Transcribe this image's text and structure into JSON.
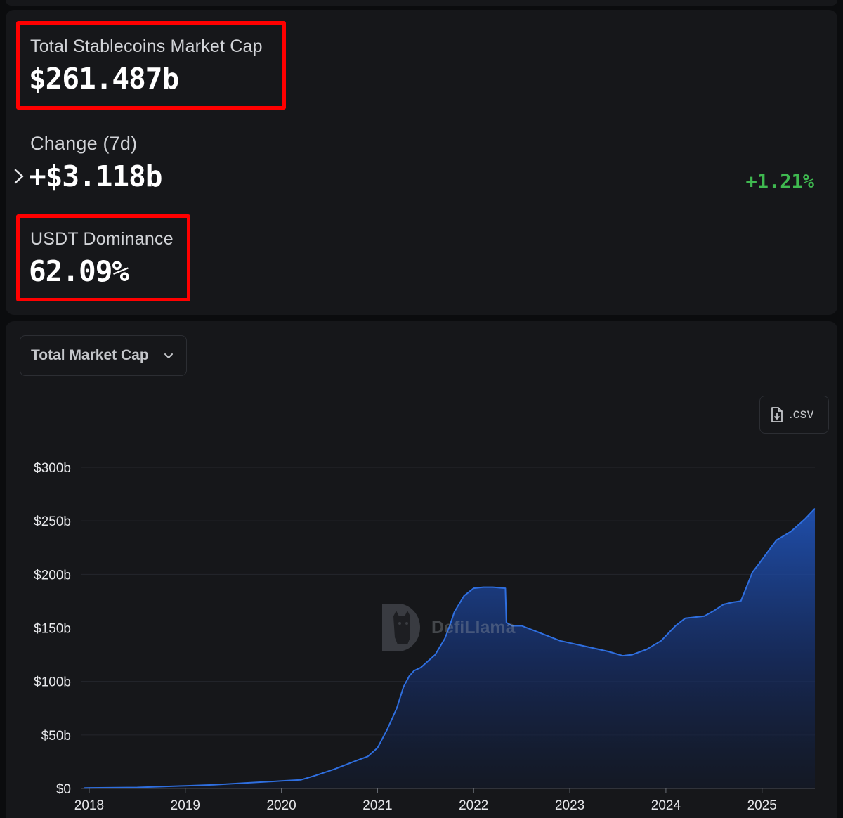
{
  "stats": {
    "total_label": "Total Stablecoins Market Cap",
    "total_value": "$261.487b",
    "change_label": "Change (7d)",
    "change_value": "+$3.118b",
    "change_pct": "+1.21%",
    "usdt_label": "USDT Dominance",
    "usdt_value": "62.09%"
  },
  "controls": {
    "dropdown_label": "Total Market Cap",
    "csv_label": ".csv"
  },
  "icons": {
    "expand": "chevron-right-icon",
    "dropdown": "chevron-down-icon",
    "csv": "file-download-icon",
    "watermark_logo": "defillama-llama-logo"
  },
  "watermark": {
    "text": "DefiLlama"
  },
  "colors": {
    "background": "#0b0c0e",
    "card": "#16171a",
    "highlight": "#ff0000",
    "positive": "#3fb950",
    "series_line": "#2f6fe0",
    "grid": "#25272c"
  },
  "chart_data": {
    "type": "area",
    "x_unit": "year",
    "x": [
      2017.95,
      2018.5,
      2019.0,
      2019.3,
      2019.6,
      2019.9,
      2020.0,
      2020.2,
      2020.35,
      2020.55,
      2020.75,
      2020.9,
      2021.0,
      2021.1,
      2021.2,
      2021.27,
      2021.33,
      2021.38,
      2021.45,
      2021.6,
      2021.7,
      2021.75,
      2021.8,
      2021.9,
      2022.0,
      2022.1,
      2022.2,
      2022.33,
      2022.34,
      2022.4,
      2022.5,
      2022.7,
      2022.9,
      2023.0,
      2023.2,
      2023.4,
      2023.55,
      2023.65,
      2023.8,
      2023.95,
      2024.1,
      2024.2,
      2024.4,
      2024.5,
      2024.6,
      2024.7,
      2024.78,
      2024.9,
      2024.97,
      2025.05,
      2025.15,
      2025.3,
      2025.45,
      2025.55
    ],
    "y": [
      0.5,
      1.0,
      2.5,
      3.5,
      5,
      6.5,
      7,
      8,
      12,
      18,
      25,
      30,
      38,
      55,
      75,
      95,
      105,
      110,
      113,
      125,
      140,
      152,
      165,
      180,
      187,
      188,
      188,
      187,
      155,
      152,
      152,
      145,
      138,
      136,
      132,
      128,
      124,
      125,
      130,
      138,
      152,
      159,
      161,
      166,
      172,
      174,
      175,
      202,
      210,
      220,
      232,
      240,
      252,
      261.487
    ],
    "ylim": [
      0,
      300
    ],
    "yticks": [
      "$0",
      "$50b",
      "$100b",
      "$150b",
      "$200b",
      "$250b",
      "$300b"
    ],
    "ytick_values": [
      0,
      50,
      100,
      150,
      200,
      250,
      300
    ],
    "xticks": [
      "2018",
      "2019",
      "2020",
      "2021",
      "2022",
      "2023",
      "2024",
      "2025"
    ],
    "xtick_values": [
      2018,
      2019,
      2020,
      2021,
      2022,
      2023,
      2024,
      2025
    ],
    "grid": true,
    "legend": "none"
  }
}
